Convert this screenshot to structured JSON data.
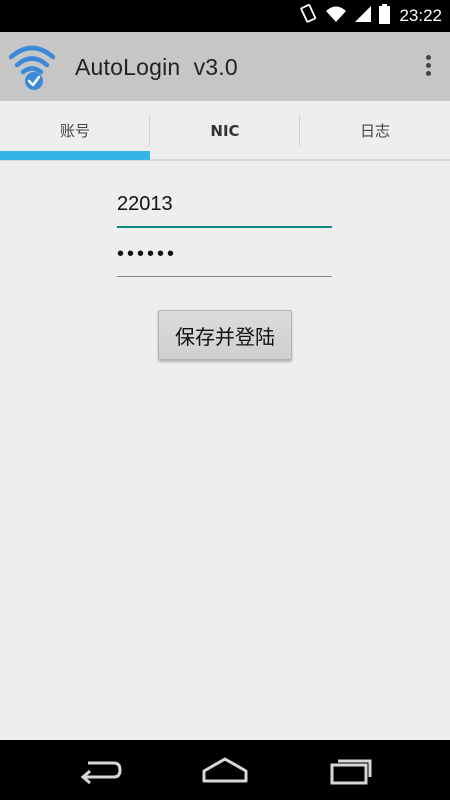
{
  "status_bar": {
    "time": "23:22",
    "icons": [
      "rotate-icon",
      "wifi-icon",
      "signal-icon",
      "battery-icon"
    ]
  },
  "app_bar": {
    "icon": "wifi-check-icon",
    "title": "AutoLogin  v3.0",
    "overflow_icon": "overflow-menu-icon"
  },
  "tabs": [
    {
      "label": "账号",
      "selected": true
    },
    {
      "label": "NIC",
      "selected": false
    },
    {
      "label": "日志",
      "selected": false
    }
  ],
  "form": {
    "username_value": "22013",
    "password_value": "••••••",
    "save_button_label": "保存并登陆"
  },
  "nav_bar": {
    "icons": [
      "back-icon",
      "home-icon",
      "recents-icon"
    ]
  },
  "colors": {
    "accent": "#33b5e5",
    "focus_underline": "#138a7e",
    "app_bar": "#c6c6c6",
    "background": "#eeeeee"
  }
}
